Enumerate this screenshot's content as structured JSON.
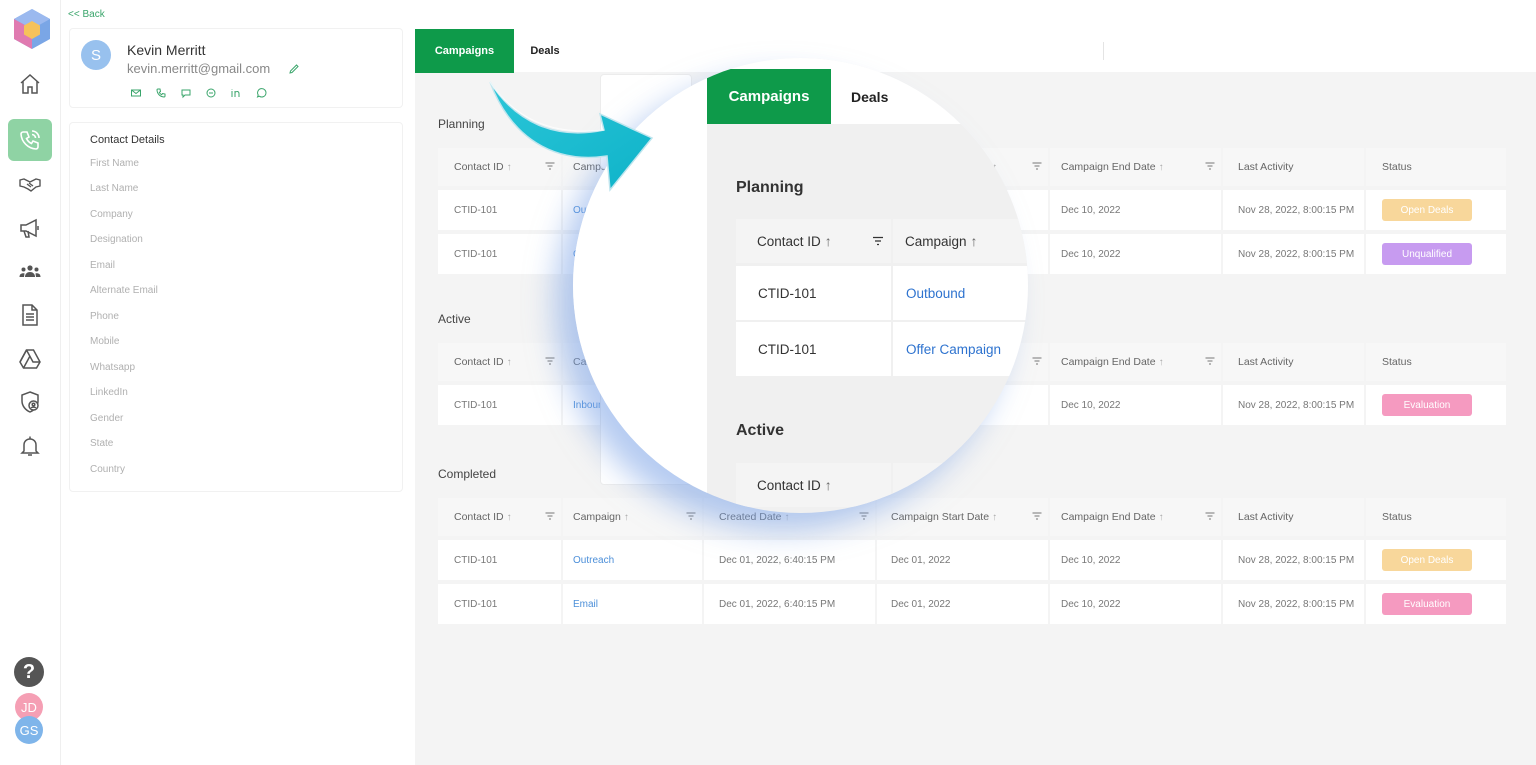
{
  "sidebar": {
    "nav": [
      {
        "icon": "home-icon"
      },
      {
        "icon": "phone-icon",
        "active": true
      },
      {
        "icon": "handshake-icon"
      },
      {
        "icon": "megaphone-icon"
      },
      {
        "icon": "team-icon"
      },
      {
        "icon": "document-icon"
      },
      {
        "icon": "drive-icon"
      },
      {
        "icon": "shield-user-icon"
      },
      {
        "icon": "bell-icon"
      }
    ],
    "help": "?",
    "avatars": [
      "JD",
      "GS"
    ]
  },
  "contact": {
    "back": "<< Back",
    "initial": "S",
    "name": "Kevin Merritt",
    "email": "kevin.merritt@gmail.com",
    "details_title": "Contact Details",
    "fields": [
      "First Name",
      "Last Name",
      "Company",
      "Designation",
      "Email",
      "Alternate Email",
      "Phone",
      "Mobile",
      "Whatsapp",
      "LinkedIn",
      "Gender",
      "State",
      "Country"
    ]
  },
  "tabs": {
    "campaigns": "Campaigns",
    "deals": "Deals"
  },
  "columns": [
    "Contact ID",
    "Campaign",
    "Created Date",
    "Campaign Start Date",
    "Campaign End Date",
    "Last Activity",
    "Status"
  ],
  "sections": {
    "planning": {
      "title": "Planning",
      "rows": [
        {
          "id": "CTID-101",
          "campaign": "Outbound",
          "created": "",
          "start": "",
          "end": "Dec 10, 2022",
          "activity": "Nov 28, 2022, 8:00:15 PM",
          "status": "Open Deals",
          "status_color": "#f8d79b"
        },
        {
          "id": "CTID-101",
          "campaign": "Offer Campaign",
          "created": "",
          "start": "",
          "end": "Dec 10, 2022",
          "activity": "Nov 28, 2022, 8:00:15 PM",
          "status": "Unqualified",
          "status_color": "#c79bf0"
        }
      ]
    },
    "active": {
      "title": "Active",
      "rows": [
        {
          "id": "CTID-101",
          "campaign": "Inbound",
          "created": "",
          "start": "",
          "end": "Dec 10, 2022",
          "activity": "Nov 28, 2022, 8:00:15 PM",
          "status": "Evaluation",
          "status_color": "#f59ac0"
        }
      ]
    },
    "completed": {
      "title": "Completed",
      "rows": [
        {
          "id": "CTID-101",
          "campaign": "Outreach",
          "created": "Dec 01, 2022, 6:40:15 PM",
          "start": "Dec 01, 2022",
          "end": "Dec 10, 2022",
          "activity": "Nov 28, 2022, 8:00:15 PM",
          "status": "Open Deals",
          "status_color": "#f8d79b"
        },
        {
          "id": "CTID-101",
          "campaign": "Email",
          "created": "Dec 01, 2022, 6:40:15 PM",
          "start": "Dec 01, 2022",
          "end": "Dec 10, 2022",
          "activity": "Nov 28, 2022, 8:00:15 PM",
          "status": "Evaluation",
          "status_color": "#f59ac0"
        }
      ]
    }
  },
  "colors": {
    "accent": "#0e9a4a",
    "link": "#4c8fd9",
    "rail_active": "#8fd3a4"
  }
}
